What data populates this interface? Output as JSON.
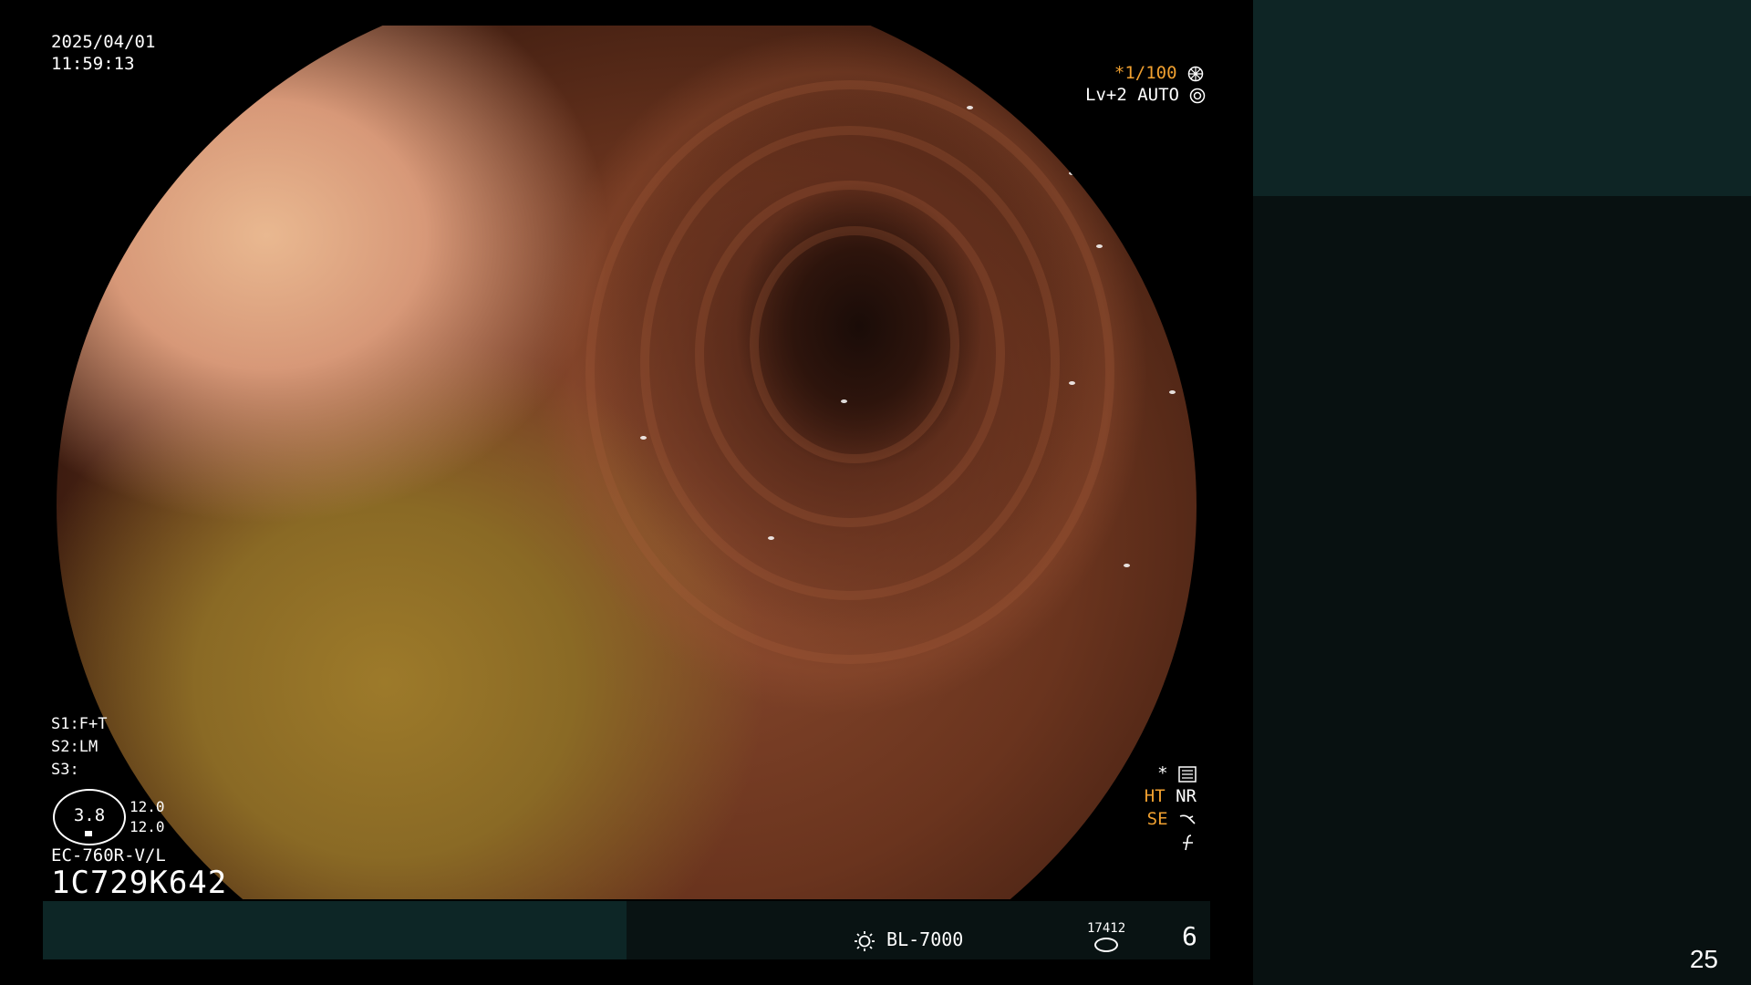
{
  "header": {
    "date": "2025/04/01",
    "time": "11:59:13"
  },
  "shutter": {
    "speed": "*1/100",
    "speed_icon": "shutter-icon",
    "level": "Lv+2",
    "mode": "AUTO",
    "mode_icon": "iris-icon"
  },
  "scope_settings": {
    "s1_label": "S1:",
    "s1_value": "F+T",
    "s2_label": "S2:",
    "s2_value": "LM",
    "s3_label": "S3:",
    "s3_value": ""
  },
  "gauge": {
    "value": "3.8",
    "set_top": "12.0",
    "set_bottom": "12.0"
  },
  "scope": {
    "model": "EC-760R-V/L",
    "serial": "1C729K642"
  },
  "processing": {
    "star": "*",
    "star_icon": "settings-icon",
    "ht": "HT",
    "nr": "NR",
    "se": "SE",
    "se_icon": "enhance-icon",
    "f_icon": "freeze-icon"
  },
  "bottom_bar": {
    "light_icon": "light-source-icon",
    "light_source": "BL-7000",
    "counter": "17412",
    "counter_icon": "disk-icon",
    "image_count": "6"
  },
  "page": {
    "number": "25"
  },
  "colors": {
    "accent": "#f0a030",
    "panel_teal": "#0e2525",
    "panel_dark": "#081111"
  }
}
